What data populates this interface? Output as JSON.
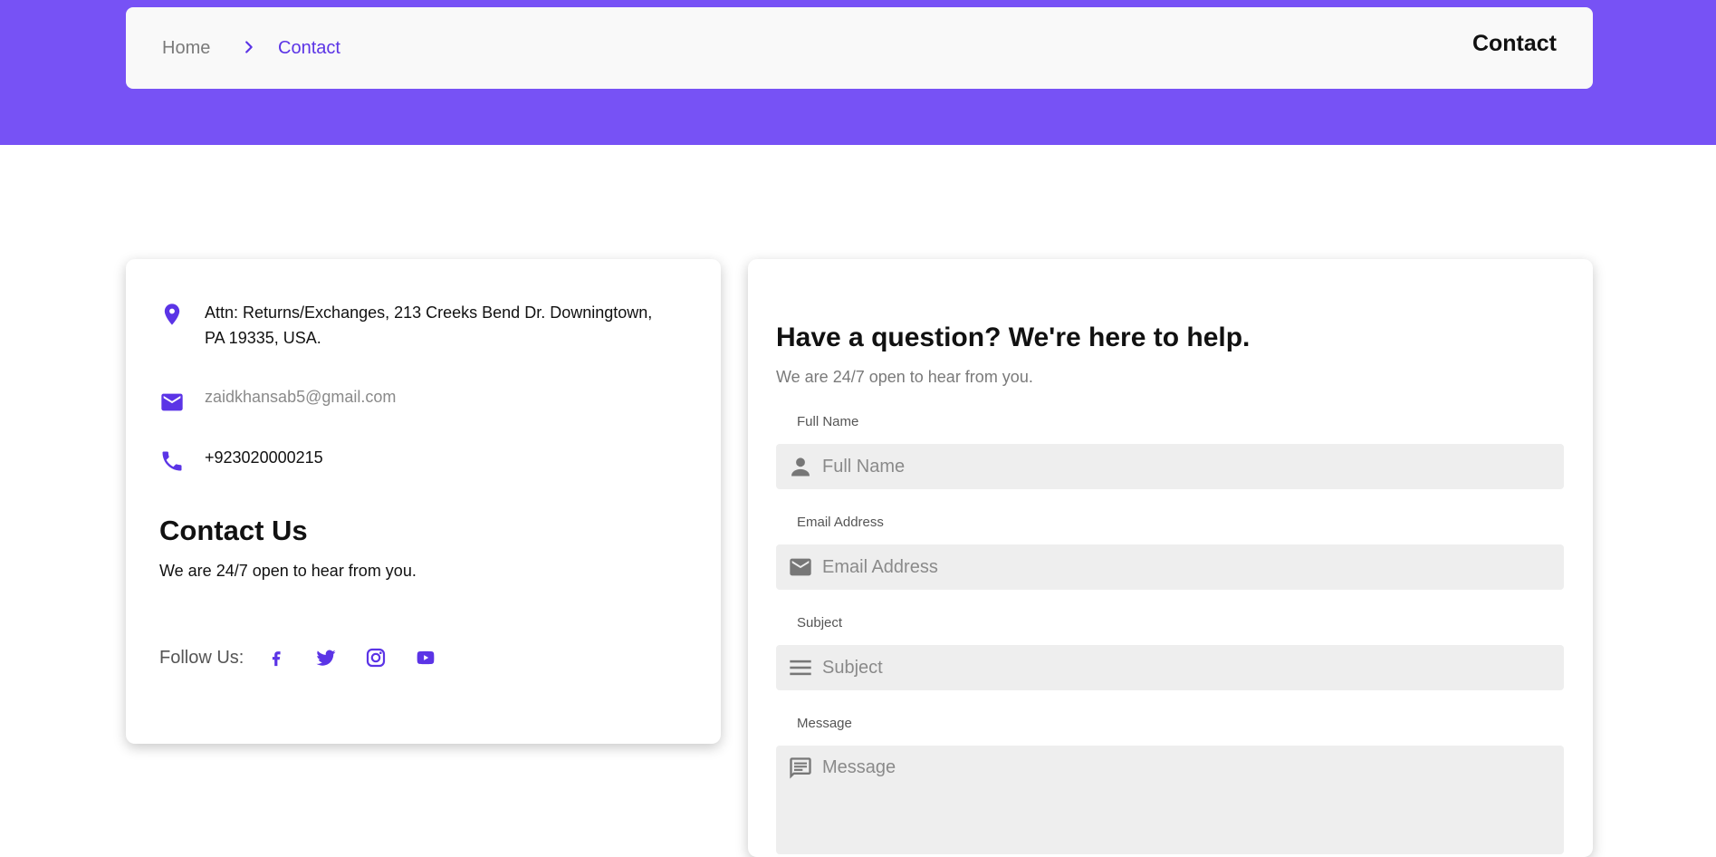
{
  "breadcrumb": {
    "home": "Home",
    "current": "Contact",
    "page_title": "Contact"
  },
  "info": {
    "address": "Attn: Returns/Exchanges, 213 Creeks Bend Dr. Downingtown, PA 19335, USA.",
    "email": "zaidkhansab5@gmail.com",
    "phone": "+923020000215",
    "heading": "Contact Us",
    "subtext": "We are 24/7 open to hear from you.",
    "follow_label": "Follow Us:",
    "social": [
      "facebook-icon",
      "twitter-icon",
      "instagram-icon",
      "youtube-icon"
    ]
  },
  "form": {
    "title": "Have a question? We're here to help.",
    "subtitle": "We are 24/7 open to hear from you.",
    "fields": [
      {
        "label": "Full Name",
        "placeholder": "Full Name",
        "icon": "person-icon"
      },
      {
        "label": "Email Address",
        "placeholder": "Email Address",
        "icon": "mail-icon"
      },
      {
        "label": "Subject",
        "placeholder": "Subject",
        "icon": "lines-icon"
      },
      {
        "label": "Message",
        "placeholder": "Message",
        "icon": "message-icon"
      }
    ]
  },
  "colors": {
    "accent": "#5b34e6",
    "hero": "#7752f5"
  }
}
